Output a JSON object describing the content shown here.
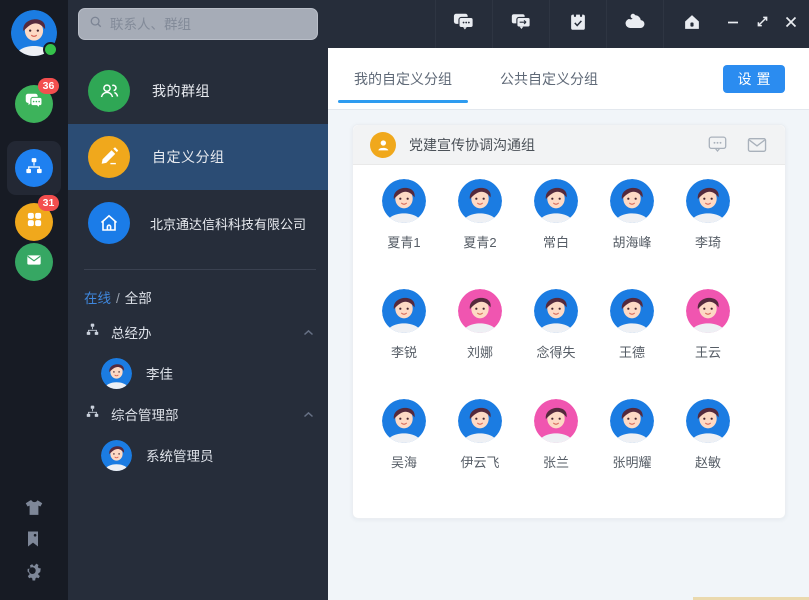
{
  "colors": {
    "avatar_male": "#1b7ce2",
    "avatar_female": "#f055b0",
    "accent_blue": "#2b8cf0",
    "badge_red": "#f34e4e",
    "selected_row": "#2b4c74",
    "menu_green": "#2fa755",
    "menu_orange": "#f0a81c",
    "menu_blue": "#1b7ce8"
  },
  "rail": {
    "user_avatar": "cartoon-avatar",
    "chat_badge": "36",
    "contacts_badge": "31",
    "icons": [
      "messages-icon",
      "org-chart-icon",
      "contacts-clover-icon",
      "mail-icon",
      "theme-shirt-icon",
      "bookmark-icon",
      "settings-gear-icon"
    ]
  },
  "topbar": {
    "search_placeholder": "联系人、群组",
    "icons": [
      "chat-dots-icon",
      "chat-forward-icon",
      "tasks-check-icon",
      "cloud-icon",
      "home-icon"
    ],
    "window_controls": [
      "minimize",
      "maximize",
      "close"
    ]
  },
  "sidebar": {
    "menu": [
      {
        "label": "我的群组",
        "icon": "group-people-icon",
        "selected": false
      },
      {
        "label": "自定义分组",
        "icon": "pencil-icon",
        "selected": true
      },
      {
        "label": "北京通达信科科技有限公司",
        "icon": "home-icon",
        "selected": false
      }
    ],
    "filter": {
      "online": "在线",
      "separator": "/",
      "all": "全部"
    },
    "tree": [
      {
        "label": "总经办",
        "members": [
          {
            "name": "李佳",
            "gender": "male"
          }
        ]
      },
      {
        "label": "综合管理部",
        "members": [
          {
            "name": "系统管理员",
            "gender": "male"
          }
        ]
      }
    ]
  },
  "main": {
    "tabs": [
      {
        "label": "我的自定义分组",
        "active": true
      },
      {
        "label": "公共自定义分组",
        "active": false
      }
    ],
    "settings_button": "设置",
    "group": {
      "title": "党建宣传协调沟通组",
      "header_icons": [
        "chat-bubble-icon",
        "envelope-icon"
      ],
      "members": [
        {
          "name": "夏青1",
          "gender": "male"
        },
        {
          "name": "夏青2",
          "gender": "male"
        },
        {
          "name": "常白",
          "gender": "male"
        },
        {
          "name": "胡海峰",
          "gender": "male"
        },
        {
          "name": "李琦",
          "gender": "male"
        },
        {
          "name": "李锐",
          "gender": "male"
        },
        {
          "name": "刘娜",
          "gender": "female"
        },
        {
          "name": "念得失",
          "gender": "male"
        },
        {
          "name": "王德",
          "gender": "male"
        },
        {
          "name": "王云",
          "gender": "female"
        },
        {
          "name": "吴海",
          "gender": "male"
        },
        {
          "name": "伊云飞",
          "gender": "male"
        },
        {
          "name": "张兰",
          "gender": "female"
        },
        {
          "name": "张明耀",
          "gender": "male"
        },
        {
          "name": "赵敏",
          "gender": "male"
        }
      ]
    }
  }
}
